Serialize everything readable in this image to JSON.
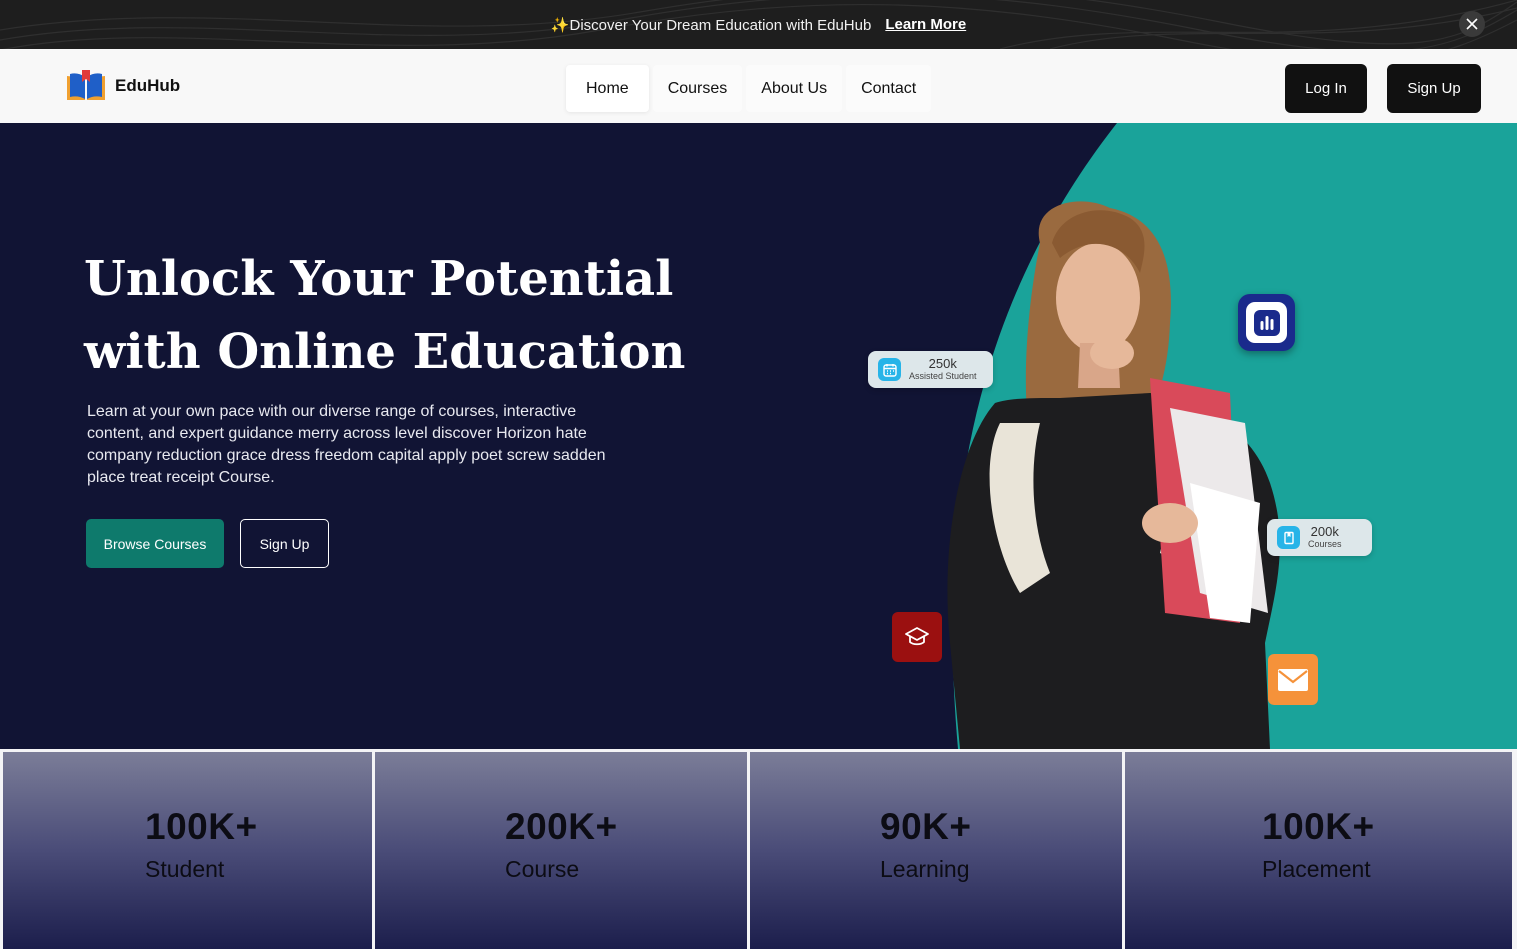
{
  "announcement": {
    "sparkle": "✨",
    "message": "Discover Your Dream Education with EduHub",
    "link_label": "Learn More",
    "close_icon": "close-icon"
  },
  "navbar": {
    "brand": "EduHub",
    "logo_icon": "open-book-icon",
    "links": [
      {
        "label": "Home",
        "active": true
      },
      {
        "label": "Courses",
        "active": false
      },
      {
        "label": "About Us",
        "active": false
      },
      {
        "label": "Contact",
        "active": false
      }
    ],
    "login_label": "Log In",
    "signup_label": "Sign Up"
  },
  "hero": {
    "title_line1": "Unlock Your Potential",
    "title_line2": "with Online Education",
    "description": "Learn at your own pace with our diverse range of courses, interactive content, and expert guidance merry across level discover Horizon hate company reduction grace dress freedom capital apply poet screw sadden place treat receipt Course.",
    "browse_label": "Browse Courses",
    "signup_label": "Sign Up",
    "chips": [
      {
        "value": "250k",
        "label": "Assisted Student",
        "icon": "calendar-icon"
      },
      {
        "value": "200k",
        "label": "Courses",
        "icon": "book-icon"
      }
    ],
    "floating_icons": [
      "bar-chart-icon",
      "graduation-cap-icon",
      "mail-icon"
    ],
    "image": "student-with-books-photo"
  },
  "stats": [
    {
      "value": "100K+",
      "label": "Student"
    },
    {
      "value": "200K+",
      "label": "Course"
    },
    {
      "value": "90K+",
      "label": "Learning"
    },
    {
      "value": "100K+",
      "label": "Placement"
    }
  ],
  "colors": {
    "announcement_bg": "#1e1e1e",
    "hero_bg": "#111434",
    "accent_teal": "#1aa39a",
    "button_teal": "#0e7a6c",
    "dark_button": "#111111",
    "chart_icon_bg": "#1a2a8c",
    "cap_icon_bg": "#9b1010",
    "mail_icon_bg": "#f5923a"
  }
}
